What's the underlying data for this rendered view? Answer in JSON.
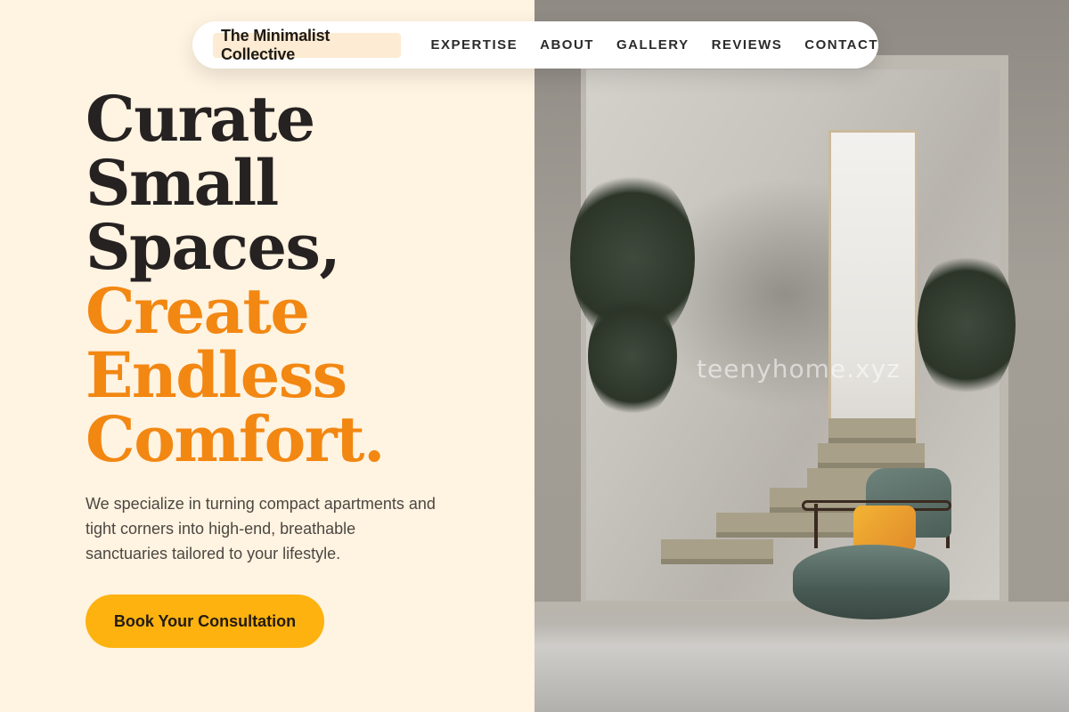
{
  "nav": {
    "brand": "The Minimalist Collective",
    "links": [
      "EXPERTISE",
      "ABOUT",
      "GALLERY",
      "REVIEWS",
      "CONTACT"
    ]
  },
  "hero": {
    "headline_dark": [
      "Curate",
      "Small",
      "Spaces,"
    ],
    "headline_accent": [
      "Create",
      "Endless",
      "Comfort."
    ],
    "lead": "We specialize in turning compact apartments and tight corners into high-end, breathable sanctuaries tailored to your lifestyle.",
    "cta_label": "Book Your Consultation"
  },
  "image": {
    "watermark": "teenyhome.xyz"
  },
  "colors": {
    "background": "#fff3e1",
    "accent": "#f28712",
    "cta": "#fdb20f",
    "dark_text": "#262222"
  }
}
